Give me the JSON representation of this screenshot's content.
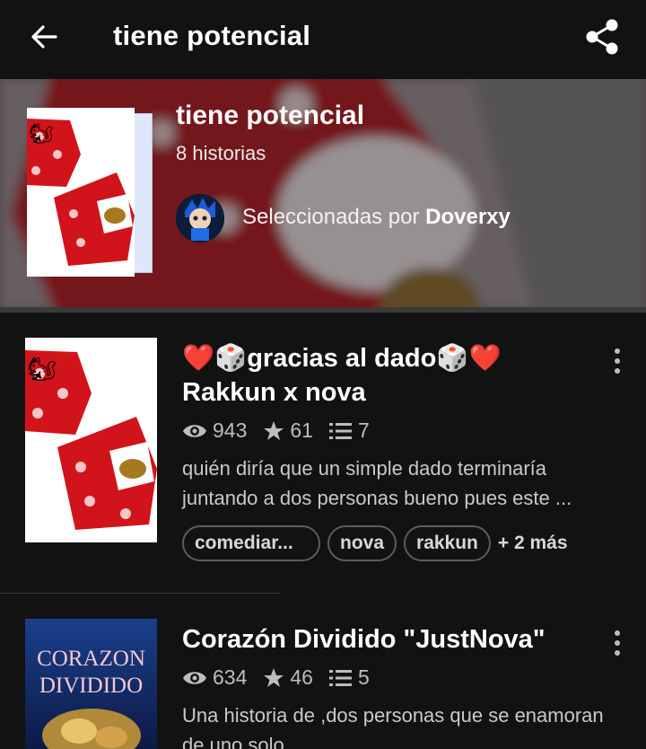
{
  "topbar": {
    "title": "tiene potencial",
    "back_icon": "back-arrow-icon",
    "share_icon": "share-icon"
  },
  "header": {
    "list_name": "tiene potencial",
    "count": "8 historias",
    "curated_prefix": "Seleccionadas por ",
    "curator": "Doverxy"
  },
  "stories": [
    {
      "title": "❤️🎲gracias al dado🎲❤️ Rakkun x nova",
      "reads": "943",
      "votes": "61",
      "parts": "7",
      "description": "quién diría que un simple dado terminaría juntando a dos personas bueno pues este ...",
      "tags": [
        "comediar...",
        "nova",
        "rakkun"
      ],
      "more_tags": "+ 2 más"
    },
    {
      "title": "Corazón Dividido \"JustNova\"",
      "reads": "634",
      "votes": "46",
      "parts": "5",
      "description": "Una historia de ,dos personas que se enamoran de uno solo...",
      "cover_text_1": "CORAZON",
      "cover_text_2": "DIVIDIDO"
    }
  ],
  "colors": {
    "background": "#121212",
    "text_secondary": "#bdbdbd",
    "dice_red": "#d1141b"
  }
}
